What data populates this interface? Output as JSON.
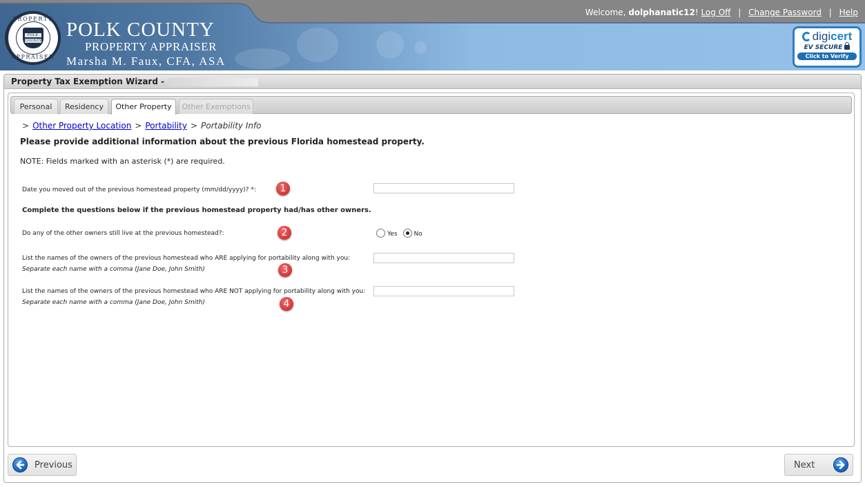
{
  "header": {
    "seal": {
      "top_text": "PROPERTY",
      "bottom_text": "APPRAISER",
      "shield_line1": "POLK",
      "shield_line2": "COUNTY"
    },
    "brand_line1": "POLK COUNTY",
    "brand_line2": "PROPERTY APPRAISER",
    "brand_line3": "Marsha M. Faux, CFA, ASA",
    "userbar": {
      "welcome_prefix": "Welcome, ",
      "username": "dolphanatic12",
      "welcome_suffix": "!",
      "logoff": "Log Off",
      "change_password": "Change Password",
      "help": "Help",
      "separator": "|"
    },
    "badge": {
      "brand_prefix": "digi",
      "brand_suffix": "cert",
      "line2": "EV SECURE",
      "line3": "Click to Verify"
    }
  },
  "wizard": {
    "title": "Property Tax Exemption Wizard -",
    "tabs": [
      {
        "label": "Personal",
        "state": "normal"
      },
      {
        "label": "Residency",
        "state": "normal"
      },
      {
        "label": "Other Property",
        "state": "active"
      },
      {
        "label": "Other Exemptions",
        "state": "disabled"
      }
    ],
    "breadcrumb": {
      "sep": ">",
      "link1": "Other Property Location",
      "link2": "Portability",
      "current": "Portability Info"
    },
    "heading": "Please provide additional information about the previous Florida homestead property.",
    "note": "NOTE: Fields marked with an asterisk (*) are required.",
    "fields": {
      "move_out_date": {
        "label": "Date you moved out of the previous homestead property (mm/dd/yyyy)? *:",
        "value": "",
        "marker": "1"
      },
      "section_heading": "Complete the questions below if the previous homestead property had/has other owners.",
      "others_live": {
        "label": "Do any of the other owners still live at the previous homestead?:",
        "options": [
          "Yes",
          "No"
        ],
        "selected": "No",
        "marker": "2"
      },
      "applying_owners": {
        "label": "List the names of the owners of the previous homestead who ARE applying for portability along with you:",
        "hint": "Separate each name with a comma (Jane Doe, John Smith)",
        "value": "",
        "marker": "3"
      },
      "not_applying_owners": {
        "label": "List the names of the owners of the previous homestead who ARE NOT applying for portability along with you:",
        "hint": "Separate each name with a comma (Jane Doe, John Smith)",
        "value": "",
        "marker": "4"
      }
    },
    "buttons": {
      "previous": "Previous",
      "next": "Next"
    }
  },
  "colors": {
    "link": "#0000cc",
    "marker": "#d93a3a",
    "header_gray": "#858585",
    "header_blue": "#95c0e7"
  }
}
